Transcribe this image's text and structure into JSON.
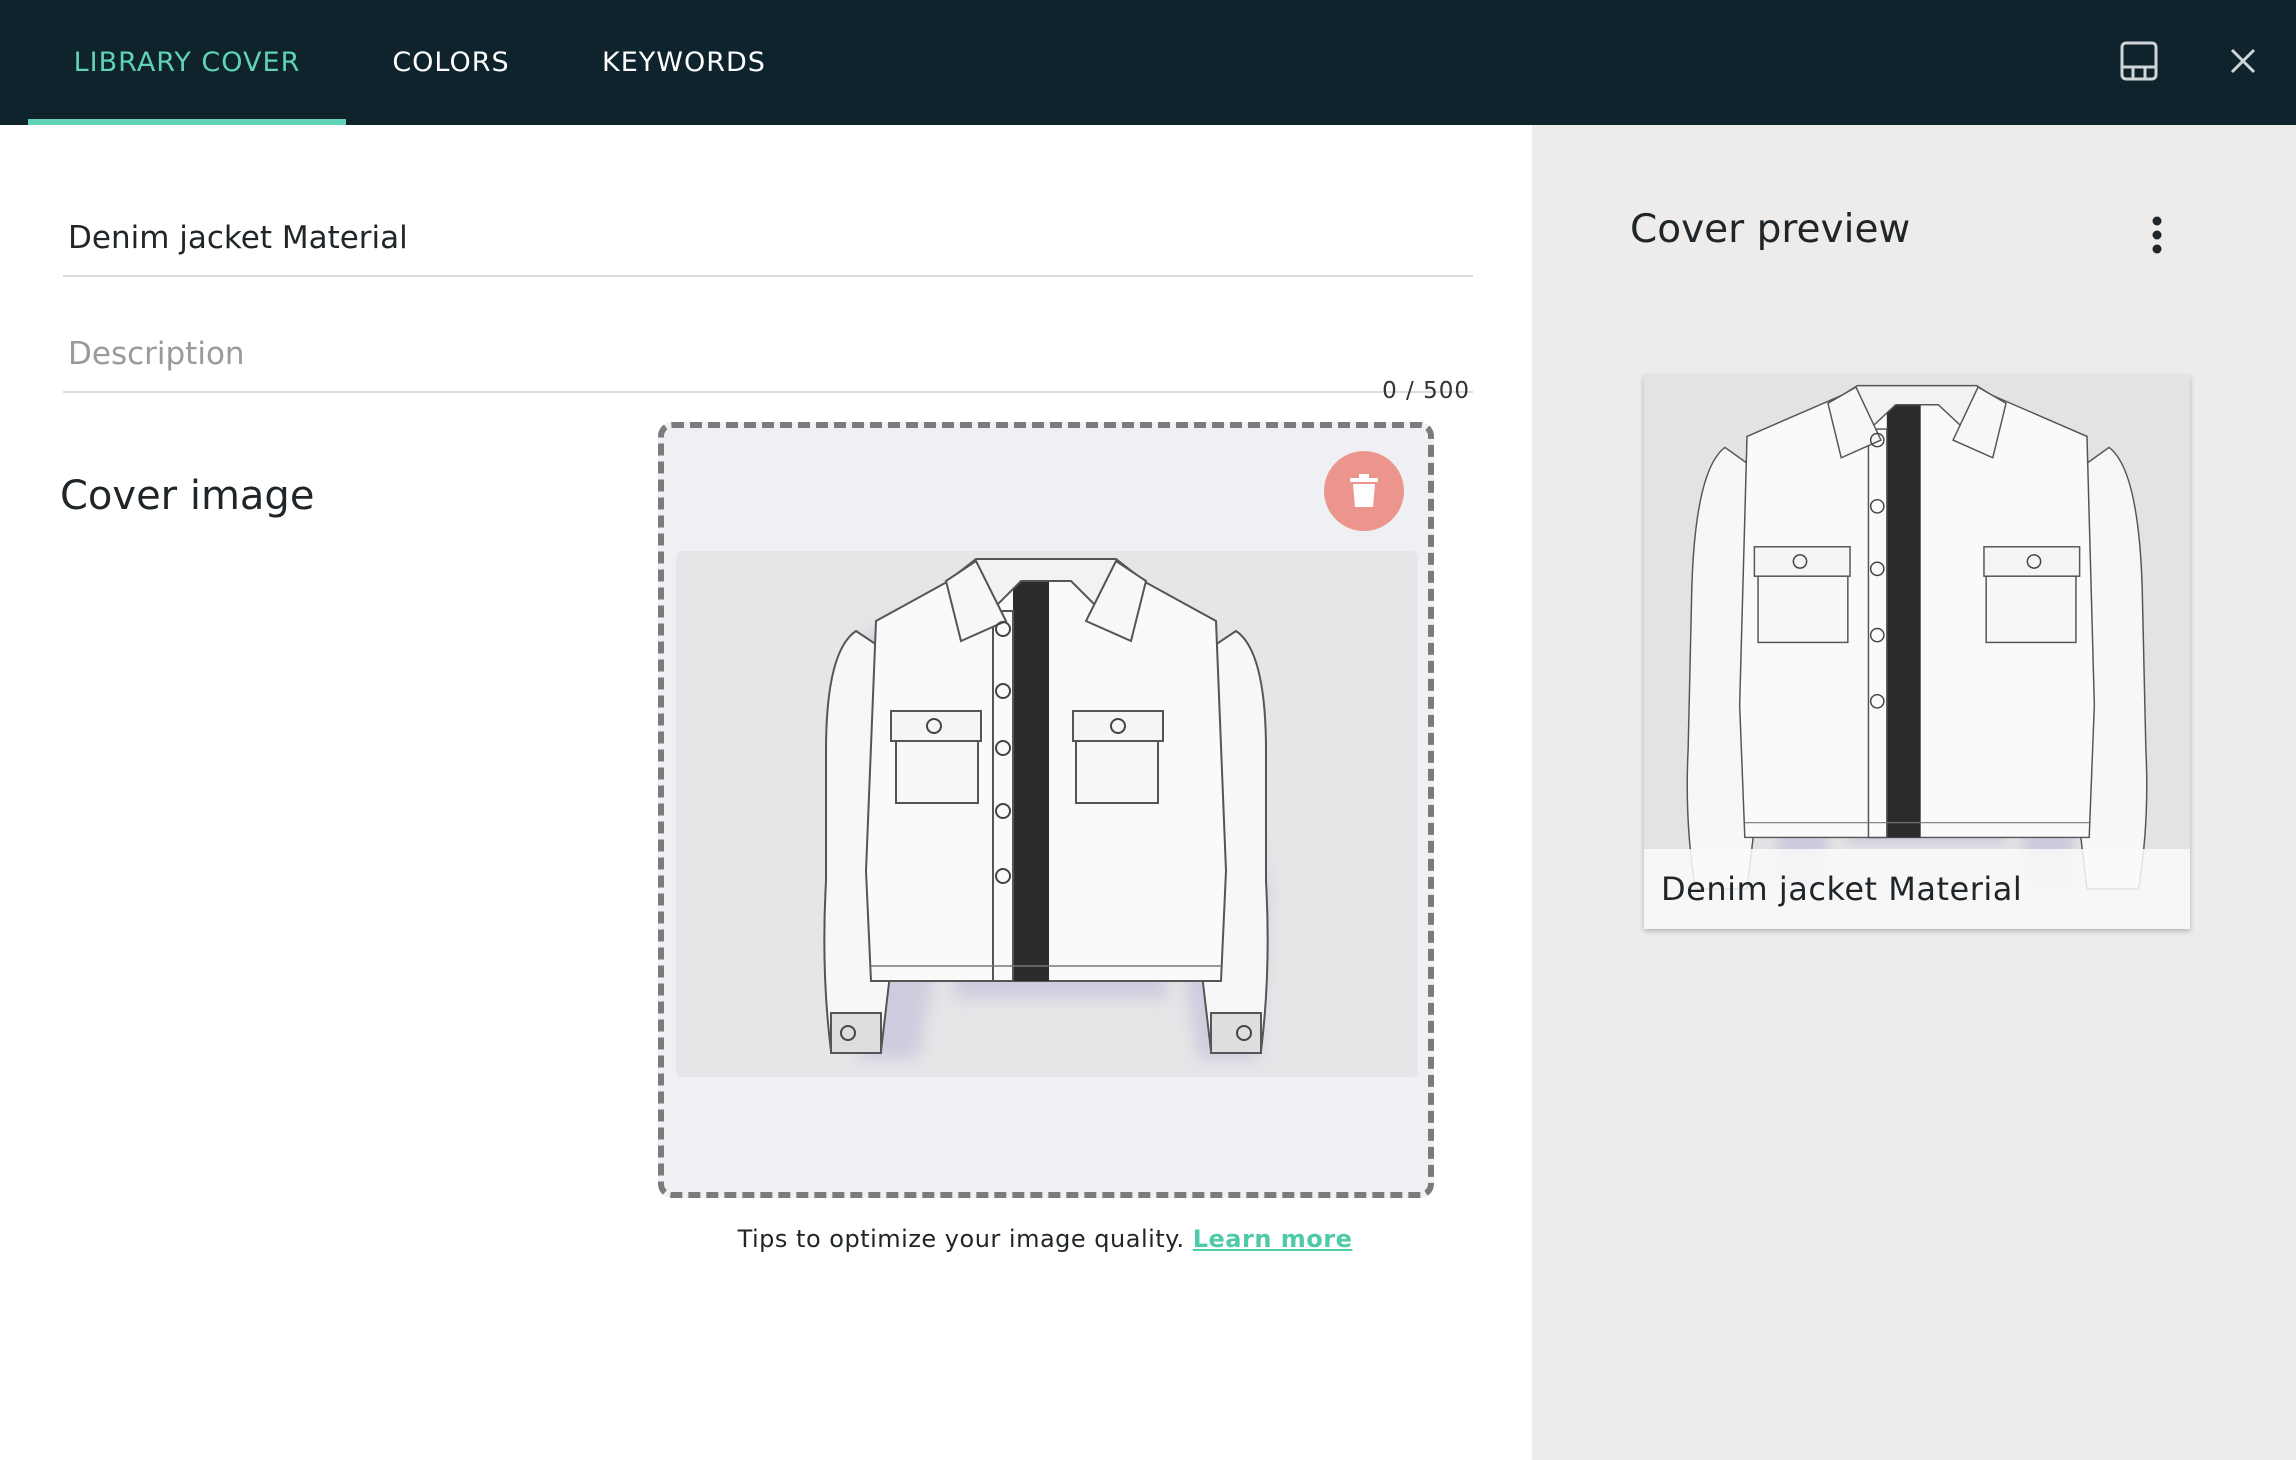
{
  "header": {
    "tabs": [
      {
        "label": "LIBRARY COVER",
        "active": true
      },
      {
        "label": "COLORS",
        "active": false
      },
      {
        "label": "KEYWORDS",
        "active": false
      }
    ],
    "icons": [
      "layout-panel-icon",
      "close-icon"
    ]
  },
  "form": {
    "name_value": "Denim jacket Material",
    "description_placeholder": "Description",
    "description_value": "",
    "counter": "0 / 500"
  },
  "cover": {
    "title": "Cover image",
    "image_icon": "jacket-image",
    "delete_icon": "trash-icon",
    "tips_text": "Tips to optimize your image quality.",
    "learn_more": "Learn more"
  },
  "preview": {
    "title": "Cover preview",
    "menu_icon": "kebab-menu-icon",
    "card_caption": "Denim jacket Material"
  },
  "colors": {
    "header_bg": "#0f232c",
    "accent": "#5fd3b3",
    "delete": "#ec958c",
    "side_bg": "#edecea"
  }
}
